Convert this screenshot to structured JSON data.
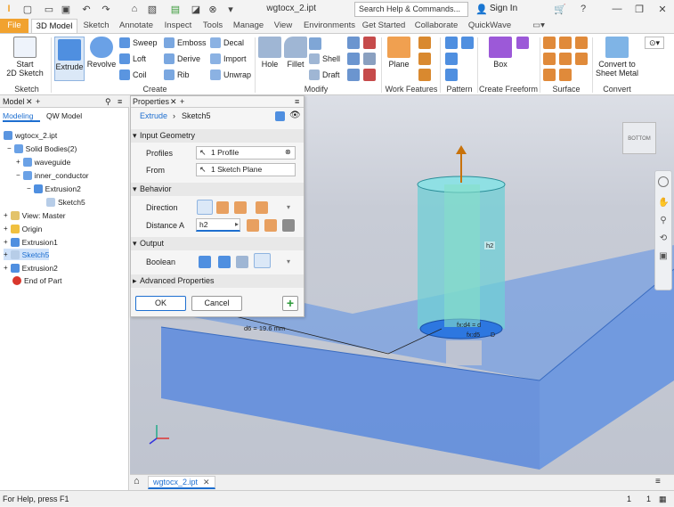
{
  "window": {
    "title": "wgtocx_2.ipt",
    "search_placeholder": "Search Help & Commands...",
    "sign_in": "Sign In"
  },
  "tabs": [
    "File",
    "3D Model",
    "Sketch",
    "Annotate",
    "Inspect",
    "Tools",
    "Manage",
    "View",
    "Environments",
    "Get Started",
    "Collaborate",
    "QuickWave"
  ],
  "ribbon": {
    "sketch": {
      "start": "Start",
      "start2": "2D Sketch",
      "label": "Sketch"
    },
    "create": {
      "extrude": "Extrude",
      "revolve": "Revolve",
      "sweep": "Sweep",
      "emboss": "Emboss",
      "decal": "Decal",
      "loft": "Loft",
      "derive": "Derive",
      "import": "Import",
      "coil": "Coil",
      "rib": "Rib",
      "unwrap": "Unwrap",
      "label": "Create"
    },
    "modify": {
      "hole": "Hole",
      "fillet": "Fillet",
      "shell": "Shell",
      "draft": "Draft",
      "label": "Modify"
    },
    "work": {
      "plane": "Plane",
      "label": "Work Features"
    },
    "pattern": {
      "label": "Pattern"
    },
    "freeform": {
      "box": "Box",
      "label": "Create Freeform"
    },
    "surface": {
      "label": "Surface"
    },
    "convert": {
      "line1": "Convert to",
      "line2": "Sheet Metal",
      "label": "Convert"
    }
  },
  "browser": {
    "title": "Model",
    "tab1": "Modeling",
    "tab2": "QW Model",
    "items": [
      {
        "label": "wgtocx_2.ipt",
        "indent": 0
      },
      {
        "label": "Solid Bodies(2)",
        "indent": 1
      },
      {
        "label": "waveguide",
        "indent": 2
      },
      {
        "label": "inner_conductor",
        "indent": 2
      },
      {
        "label": "Extrusion2",
        "indent": 3
      },
      {
        "label": "Sketch5",
        "indent": 4
      },
      {
        "label": "View: Master",
        "indent": 0
      },
      {
        "label": "Origin",
        "indent": 0
      },
      {
        "label": "Extrusion1",
        "indent": 0
      },
      {
        "label": "Sketch5",
        "indent": 0
      },
      {
        "label": "Extrusion2",
        "indent": 0
      },
      {
        "label": "End of Part",
        "indent": 0
      }
    ]
  },
  "props": {
    "title": "Properties",
    "crumb1": "Extrude",
    "crumb2": "Sketch5",
    "input_geometry": "Input Geometry",
    "profiles_label": "Profiles",
    "profiles_value": "1 Profile",
    "from_label": "From",
    "from_value": "1 Sketch Plane",
    "behavior": "Behavior",
    "direction_label": "Direction",
    "distance_label": "Distance A",
    "distance_value": "h2",
    "output": "Output",
    "boolean_label": "Boolean",
    "advanced": "Advanced Properties",
    "ok": "OK",
    "cancel": "Cancel"
  },
  "viewport": {
    "dim_d6": "d6 = 19.6 mm",
    "dim_h2": "h2",
    "dim_d4": "fx:d4 = d",
    "dim_d5": "fx:d5",
    "dim_D": "D",
    "viewcube": "BOTTOM"
  },
  "doc_tab": "wgtocx_2.ipt",
  "status": {
    "help": "For Help, press F1",
    "n1": "1",
    "n2": "1"
  },
  "colors": {
    "accent": "#1e6fd0",
    "file_tab": "#f1a22f",
    "body_blue": "#5b8fe6",
    "cylinder": "#6fcfd6"
  }
}
